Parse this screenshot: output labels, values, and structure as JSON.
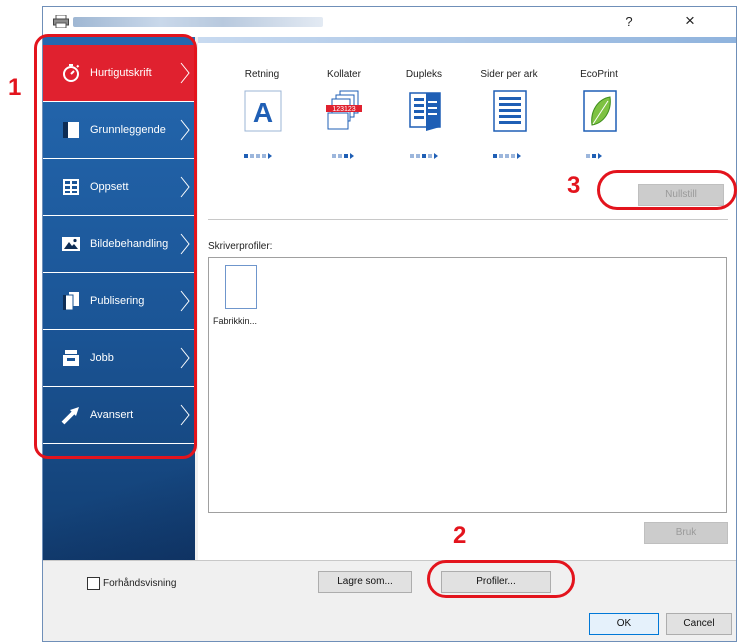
{
  "window": {
    "help": "?",
    "close": "×"
  },
  "sidebar": {
    "items": [
      {
        "label": "Hurtigutskrift",
        "icon": "stopwatch-icon"
      },
      {
        "label": "Grunnleggende",
        "icon": "document-icon"
      },
      {
        "label": "Oppsett",
        "icon": "layout-icon"
      },
      {
        "label": "Bildebehandling",
        "icon": "image-icon"
      },
      {
        "label": "Publisering",
        "icon": "publishing-icon"
      },
      {
        "label": "Jobb",
        "icon": "job-icon"
      },
      {
        "label": "Avansert",
        "icon": "arrow-icon"
      }
    ]
  },
  "features": [
    {
      "label": "Retning",
      "icon": "orientation-a-icon",
      "dots": [
        "on",
        "off",
        "off",
        "off"
      ]
    },
    {
      "label": "Kollater",
      "icon": "collate-icon",
      "dots": [
        "off",
        "off",
        "on"
      ]
    },
    {
      "label": "Dupleks",
      "icon": "duplex-icon",
      "dots": [
        "off",
        "off",
        "on",
        "off"
      ]
    },
    {
      "label": "Sider per ark",
      "icon": "pages-per-sheet-icon",
      "dots": [
        "on",
        "off",
        "off",
        "off"
      ]
    },
    {
      "label": "EcoPrint",
      "icon": "leaf-icon",
      "dots": [
        "off",
        "on"
      ]
    }
  ],
  "collate_badge": "123123",
  "buttons": {
    "reset": "Nullstill",
    "apply": "Bruk",
    "save_as": "Lagre som...",
    "profiles": "Profiler...",
    "ok": "OK",
    "cancel": "Cancel"
  },
  "profiles": {
    "label": "Skriverprofiler:",
    "items": [
      {
        "name": "Fabrikkin..."
      }
    ]
  },
  "preview": {
    "label": "Forhåndsvisning",
    "checked": false
  },
  "callouts": [
    "1",
    "2",
    "3"
  ],
  "colors": {
    "accent_red": "#e3141d",
    "sidebar_blue": "#1b5596",
    "active_item": "#e0212f"
  }
}
